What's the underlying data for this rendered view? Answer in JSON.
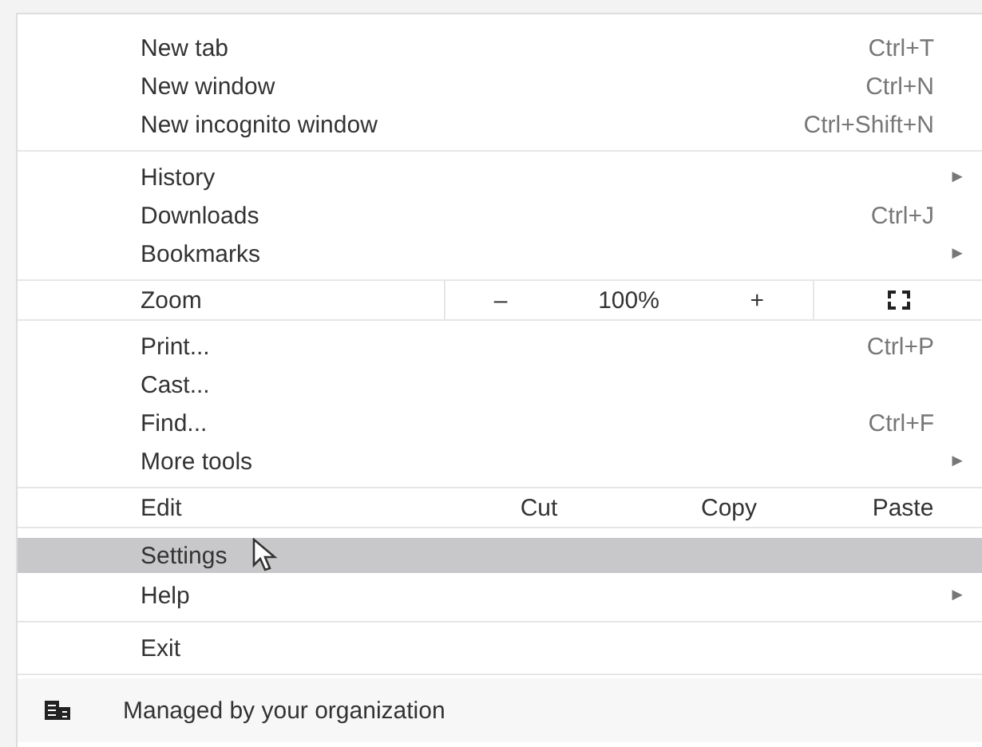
{
  "sections": [
    {
      "items": [
        {
          "kind": "item",
          "label": "New tab",
          "shortcut": "Ctrl+T",
          "highlighted": false
        },
        {
          "kind": "item",
          "label": "New window",
          "shortcut": "Ctrl+N",
          "highlighted": false
        },
        {
          "kind": "item",
          "label": "New incognito window",
          "shortcut": "Ctrl+Shift+N",
          "highlighted": false
        }
      ]
    },
    {
      "items": [
        {
          "kind": "item",
          "label": "History",
          "arrow": "►",
          "highlighted": false
        },
        {
          "kind": "item",
          "label": "Downloads",
          "shortcut": "Ctrl+J",
          "highlighted": false
        },
        {
          "kind": "item",
          "label": "Bookmarks",
          "arrow": "►",
          "highlighted": false
        }
      ]
    },
    {
      "items": [
        {
          "kind": "zoom",
          "label": "Zoom",
          "minus": "–",
          "value": "100%",
          "plus": "+"
        }
      ]
    },
    {
      "items": [
        {
          "kind": "item",
          "label": "Print...",
          "shortcut": "Ctrl+P",
          "highlighted": false
        },
        {
          "kind": "item",
          "label": "Cast...",
          "highlighted": false
        },
        {
          "kind": "item",
          "label": "Find...",
          "shortcut": "Ctrl+F",
          "highlighted": false
        },
        {
          "kind": "item",
          "label": "More tools",
          "arrow": "►",
          "highlighted": false
        }
      ]
    },
    {
      "items": [
        {
          "kind": "edit",
          "label": "Edit",
          "actions": [
            "Cut",
            "Copy",
            "Paste"
          ]
        }
      ]
    },
    {
      "items": [
        {
          "kind": "item",
          "label": "Settings",
          "highlighted": true
        },
        {
          "kind": "item",
          "label": "Help",
          "arrow": "►",
          "highlighted": false
        }
      ]
    },
    {
      "items": [
        {
          "kind": "item",
          "label": "Exit",
          "highlighted": false
        }
      ]
    }
  ],
  "footer": {
    "label": "Managed by your organization"
  }
}
